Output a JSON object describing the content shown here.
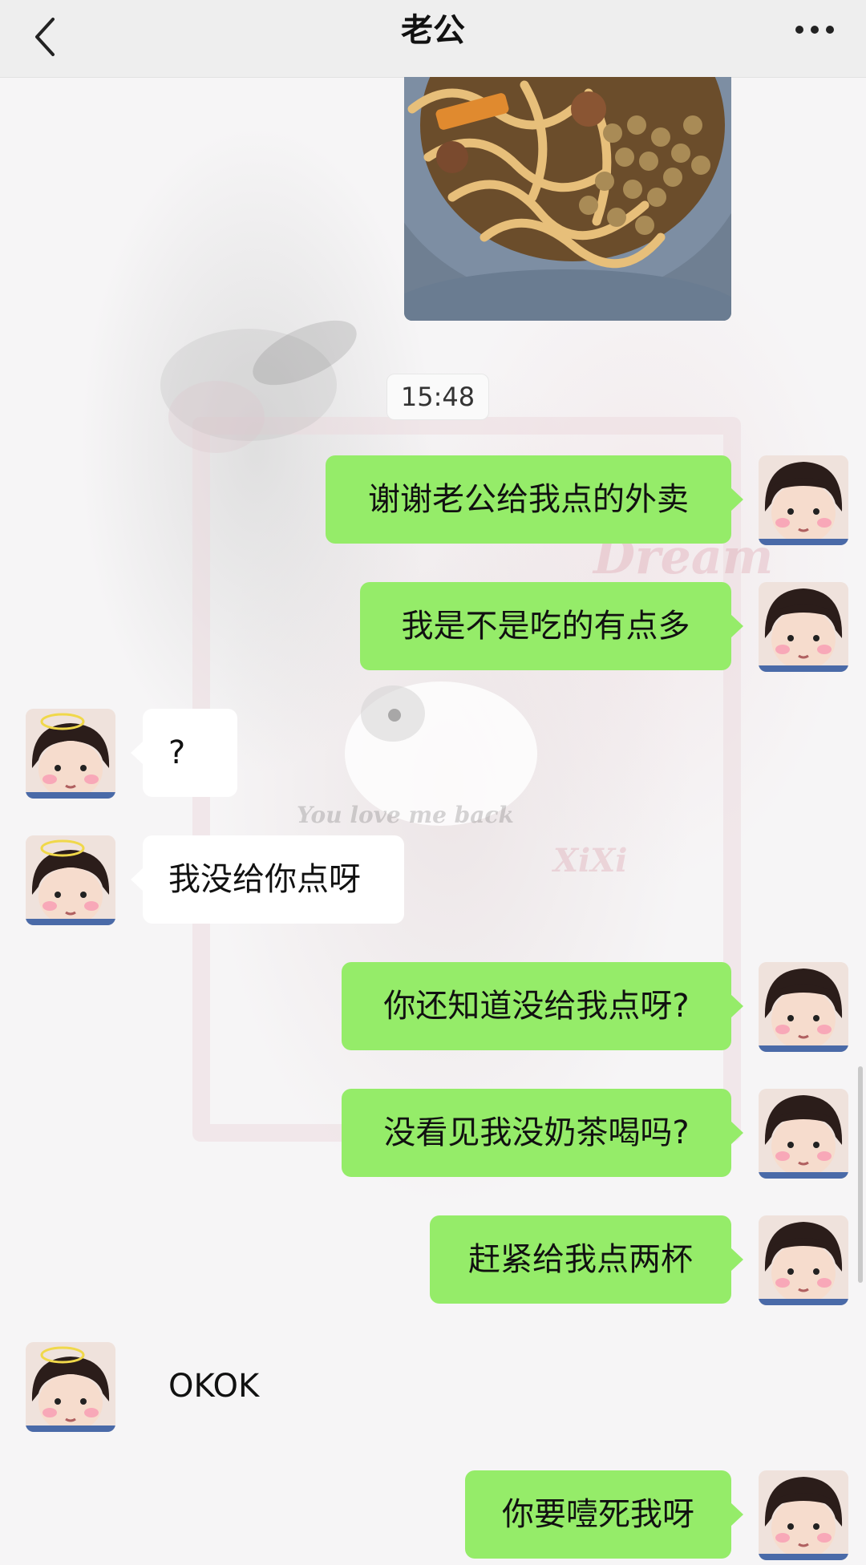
{
  "header": {
    "title": "老公",
    "back_icon": "chevron-left-icon",
    "more_icon": "more-dots-icon"
  },
  "chat": {
    "timestamp": "15:48",
    "messages": [
      {
        "side": "out",
        "text": "谢谢老公给我点的外卖"
      },
      {
        "side": "out",
        "text": "我是不是吃的有点多"
      },
      {
        "side": "in",
        "text": "?"
      },
      {
        "side": "in",
        "text": "我没给你点呀"
      },
      {
        "side": "out",
        "text": "你还知道没给我点呀?"
      },
      {
        "side": "out",
        "text": "没看见我没奶茶喝吗?"
      },
      {
        "side": "out",
        "text": "赶紧给我点两杯"
      },
      {
        "side": "in",
        "text": "OKOK"
      },
      {
        "side": "out",
        "text": "你要噎死我呀"
      }
    ]
  },
  "background_deco": {
    "words": [
      "Dream",
      "XiXi",
      "You love me back"
    ]
  },
  "colors": {
    "out_bubble": "#95ec69",
    "in_bubble": "#ffffff",
    "header_bg": "#eeeeee"
  }
}
